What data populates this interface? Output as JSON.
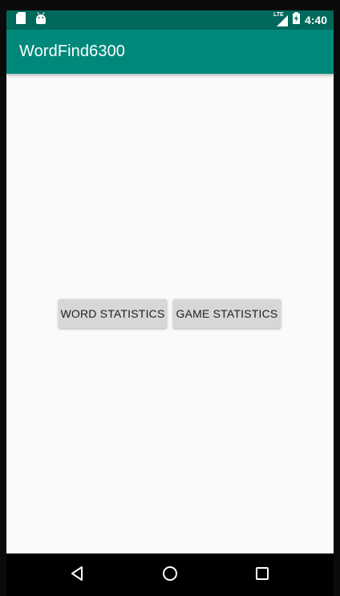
{
  "status_bar": {
    "time": "4:40",
    "network_label": "LTE",
    "icons": [
      "sd-card-icon",
      "android-icon",
      "lte-signal-icon",
      "battery-charging-icon"
    ],
    "color": "#00695c"
  },
  "app_bar": {
    "title": "WordFind6300",
    "color": "#00897b"
  },
  "main": {
    "buttons": [
      {
        "label": "WORD STATISTICS"
      },
      {
        "label": "GAME STATISTICS"
      }
    ],
    "background": "#fafafa"
  },
  "nav_bar": {
    "icons": [
      "back-icon",
      "home-icon",
      "recents-icon"
    ]
  }
}
